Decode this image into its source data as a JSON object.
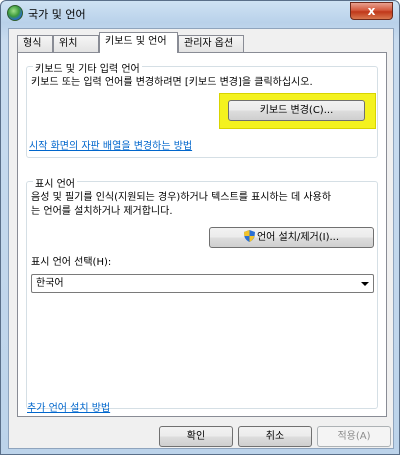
{
  "window": {
    "title": "국가 및 언어",
    "close_glyph": "x"
  },
  "tabs": [
    {
      "label": "형식"
    },
    {
      "label": "위치"
    },
    {
      "label": "키보드 및 언어"
    },
    {
      "label": "관리자 옵션"
    }
  ],
  "keyboards": {
    "group_title": "키보드 및 기타 입력 언어",
    "description": "키보드 또는 입력 언어를 변경하려면 [키보드 변경]을 클릭하십시오.",
    "change_button": "키보드 변경(C)...",
    "welcome_link": "시작 화면의 자판 배열을 변경하는 방법"
  },
  "display_language": {
    "group_title": "표시 언어",
    "description_line1": "음성 및 필기를 인식(지원되는 경우)하거나 텍스트를 표시하는 데 사용하",
    "description_line2": "는 언어를 설치하거나 제거합니다.",
    "install_button": "언어 설치/제거(I)...",
    "select_label": "표시 언어 선택(H):",
    "selected_value": "한국어"
  },
  "footer": {
    "install_link": "추가 언어 설치 방법",
    "ok": "확인",
    "cancel": "취소",
    "apply": "적용(A)"
  },
  "colors": {
    "link": "#0066cc",
    "highlight": "#f4f21f"
  }
}
